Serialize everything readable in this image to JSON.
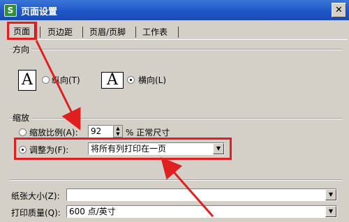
{
  "window": {
    "title": "页面设置",
    "app_icon_letter": "S",
    "close_glyph": "✕"
  },
  "tabs": [
    {
      "label": "页面"
    },
    {
      "label": "页边距"
    },
    {
      "label": "页眉/页脚"
    },
    {
      "label": "工作表"
    }
  ],
  "orientation": {
    "group_label": "方向",
    "portrait_icon": "A",
    "portrait_label": "纵向(T)",
    "landscape_icon": "A",
    "landscape_label": "横向(L)",
    "selected": "landscape"
  },
  "scaling": {
    "group_label": "缩放",
    "adjust_label": "缩放比例(A):",
    "adjust_value": "92",
    "adjust_suffix": "% 正常尺寸",
    "fit_label": "调整为(F):",
    "fit_value": "将所有列打印在一页",
    "selected": "fit"
  },
  "paper": {
    "size_label": "纸张大小(Z):",
    "size_value": "",
    "quality_label": "打印质量(Q):",
    "quality_value": "600 点/英寸"
  },
  "colors": {
    "annotation": "#e02020",
    "title_bar": "#1f56c7"
  }
}
